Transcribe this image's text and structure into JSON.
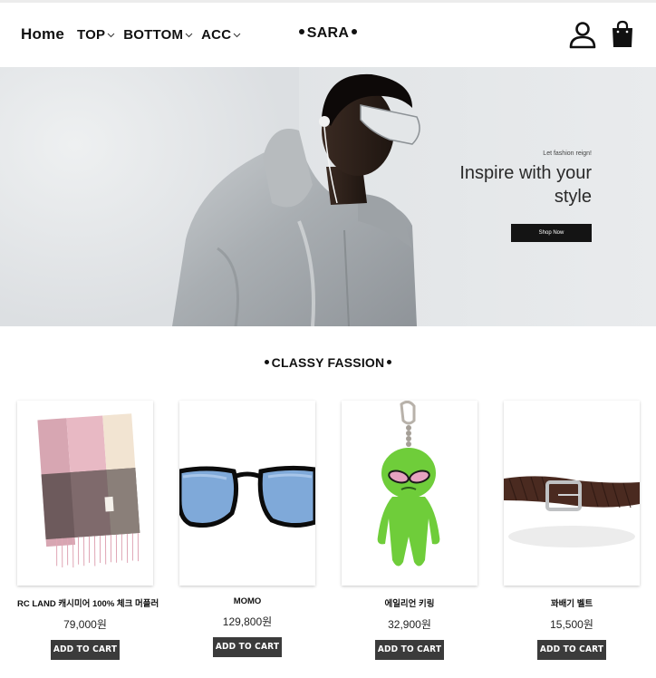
{
  "header": {
    "home": "Home",
    "menus": [
      {
        "label": "TOP"
      },
      {
        "label": "BOTTOM"
      },
      {
        "label": "ACC"
      }
    ],
    "brand": "SARA"
  },
  "hero": {
    "eyebrow": "Let fashion reign!",
    "title_line1": "Inspire with your",
    "title_line2": "style",
    "button": "Shop Now"
  },
  "section": {
    "title": "CLASSY FASSION"
  },
  "products": [
    {
      "name": "RC LAND 캐시미어 100% 체크 머플러",
      "price": "79,000원",
      "cart": "ADD TO CART"
    },
    {
      "name": "MOMO",
      "price": "129,800원",
      "cart": "ADD TO CART"
    },
    {
      "name": "에일리언 키링",
      "price": "32,900원",
      "cart": "ADD TO CART"
    },
    {
      "name": "꽈배기 벨트",
      "price": "15,500원",
      "cart": "ADD TO CART"
    }
  ],
  "icons": {
    "user": "user-icon",
    "bag": "shopping-bag-icon",
    "chevron": "chevron-down-icon"
  }
}
